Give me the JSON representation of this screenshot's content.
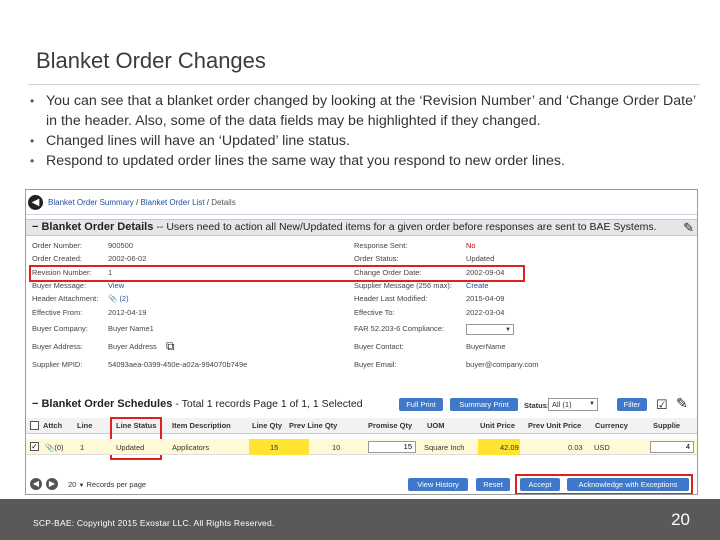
{
  "slide": {
    "title": "Blanket Order Changes",
    "bullets": [
      "You can see that a blanket order changed by looking at the ‘Revision Number’ and ‘Change Order Date’ in the header.  Also, some of the data fields may be highlighted if they changed.",
      "Changed lines will have an ‘Updated’ line status.",
      "Respond to updated order lines the same way that you respond to new order lines."
    ],
    "bullet_glyph": "•",
    "footer": "SCP-BAE:  Copyright 2015 Exostar LLC. All Rights Reserved.",
    "page_number": "20"
  },
  "screenshot": {
    "breadcrumb": [
      "Blanket Order Summary",
      "Blanket Order List",
      "Details"
    ],
    "breadcrumb_sep": "/",
    "details_title": "Blanket Order Details",
    "details_subtitle": "-- Users need to action all New/Updated items for a given order before responses are sent to BAE Systems.",
    "details_left": [
      {
        "label": "Order Number:",
        "value": "900500"
      },
      {
        "label": "Order Created:",
        "value": "2002-06-02"
      },
      {
        "label": "Revision Number:",
        "value": "1"
      },
      {
        "label": "Buyer Message:",
        "value": "View"
      },
      {
        "label": "Header Attachment:",
        "value": "(2)"
      },
      {
        "label": "Effective From:",
        "value": "2012-04-19"
      },
      {
        "label": "Buyer Company:",
        "value": "Buyer Name1"
      },
      {
        "label": "Buyer Address:",
        "value": "Buyer Address"
      },
      {
        "label": "Supplier MPID:",
        "value": "54093aea-0399-450e-a02a-994070b749e"
      }
    ],
    "details_right": [
      {
        "label": "Response Sent:",
        "value": "No"
      },
      {
        "label": "Order Status:",
        "value": "Updated"
      },
      {
        "label": "Change Order Date:",
        "value": "2002-09-04"
      },
      {
        "label": "Supplier Message (256 max):",
        "value": "Create"
      },
      {
        "label": "Header Last Modified:",
        "value": "2015-04-09"
      },
      {
        "label": "Effective To:",
        "value": "2022-03-04"
      },
      {
        "label": "FAR 52.203-6 Compliance:",
        "value": ""
      },
      {
        "label": "Buyer Contact:",
        "value": "BuyerName"
      },
      {
        "label": "Buyer Email:",
        "value": "buyer@company.com"
      }
    ],
    "schedules_title": "Blanket Order Schedules",
    "schedules_subtitle": "- Total 1 records Page 1 of 1, 1 Selected",
    "btn_full_print": "Full Print",
    "btn_summary_print": "Summary Print",
    "status_label": "Status:",
    "status_value": "All (1)",
    "btn_filter": "Filter",
    "columns": [
      "Attch",
      "Line",
      "Line Status",
      "Item Description",
      "Line Qty",
      "Prev Line Qty",
      "Promise Qty",
      "UOM",
      "Unit Price",
      "Prev Unit Price",
      "Currency",
      "Supplie"
    ],
    "row": {
      "checked": "✓",
      "attch": "(0)",
      "line": "1",
      "line_status": "Updated",
      "item_description": "Applicators",
      "line_qty": "15",
      "prev_line_qty": "10",
      "promise_qty": "15",
      "uom": "Square Inch",
      "unit_price": "42.09",
      "prev_unit_price": "0.03",
      "currency": "USD",
      "supplier": "4"
    },
    "records_per_page_value": "20",
    "records_per_page_label": "Records per page",
    "btn_view_history": "View History",
    "btn_reset": "Reset",
    "btn_accept": "Accept",
    "btn_ack_exceptions": "Acknowledge with Exceptions"
  },
  "colors": {
    "footer_bg": "#595959",
    "button_blue": "#3f78c9",
    "highlight_red": "#e02020",
    "row_yellow": "#fff9d6",
    "cell_yellow": "#ffe433",
    "link_blue": "#1f4e9a"
  }
}
